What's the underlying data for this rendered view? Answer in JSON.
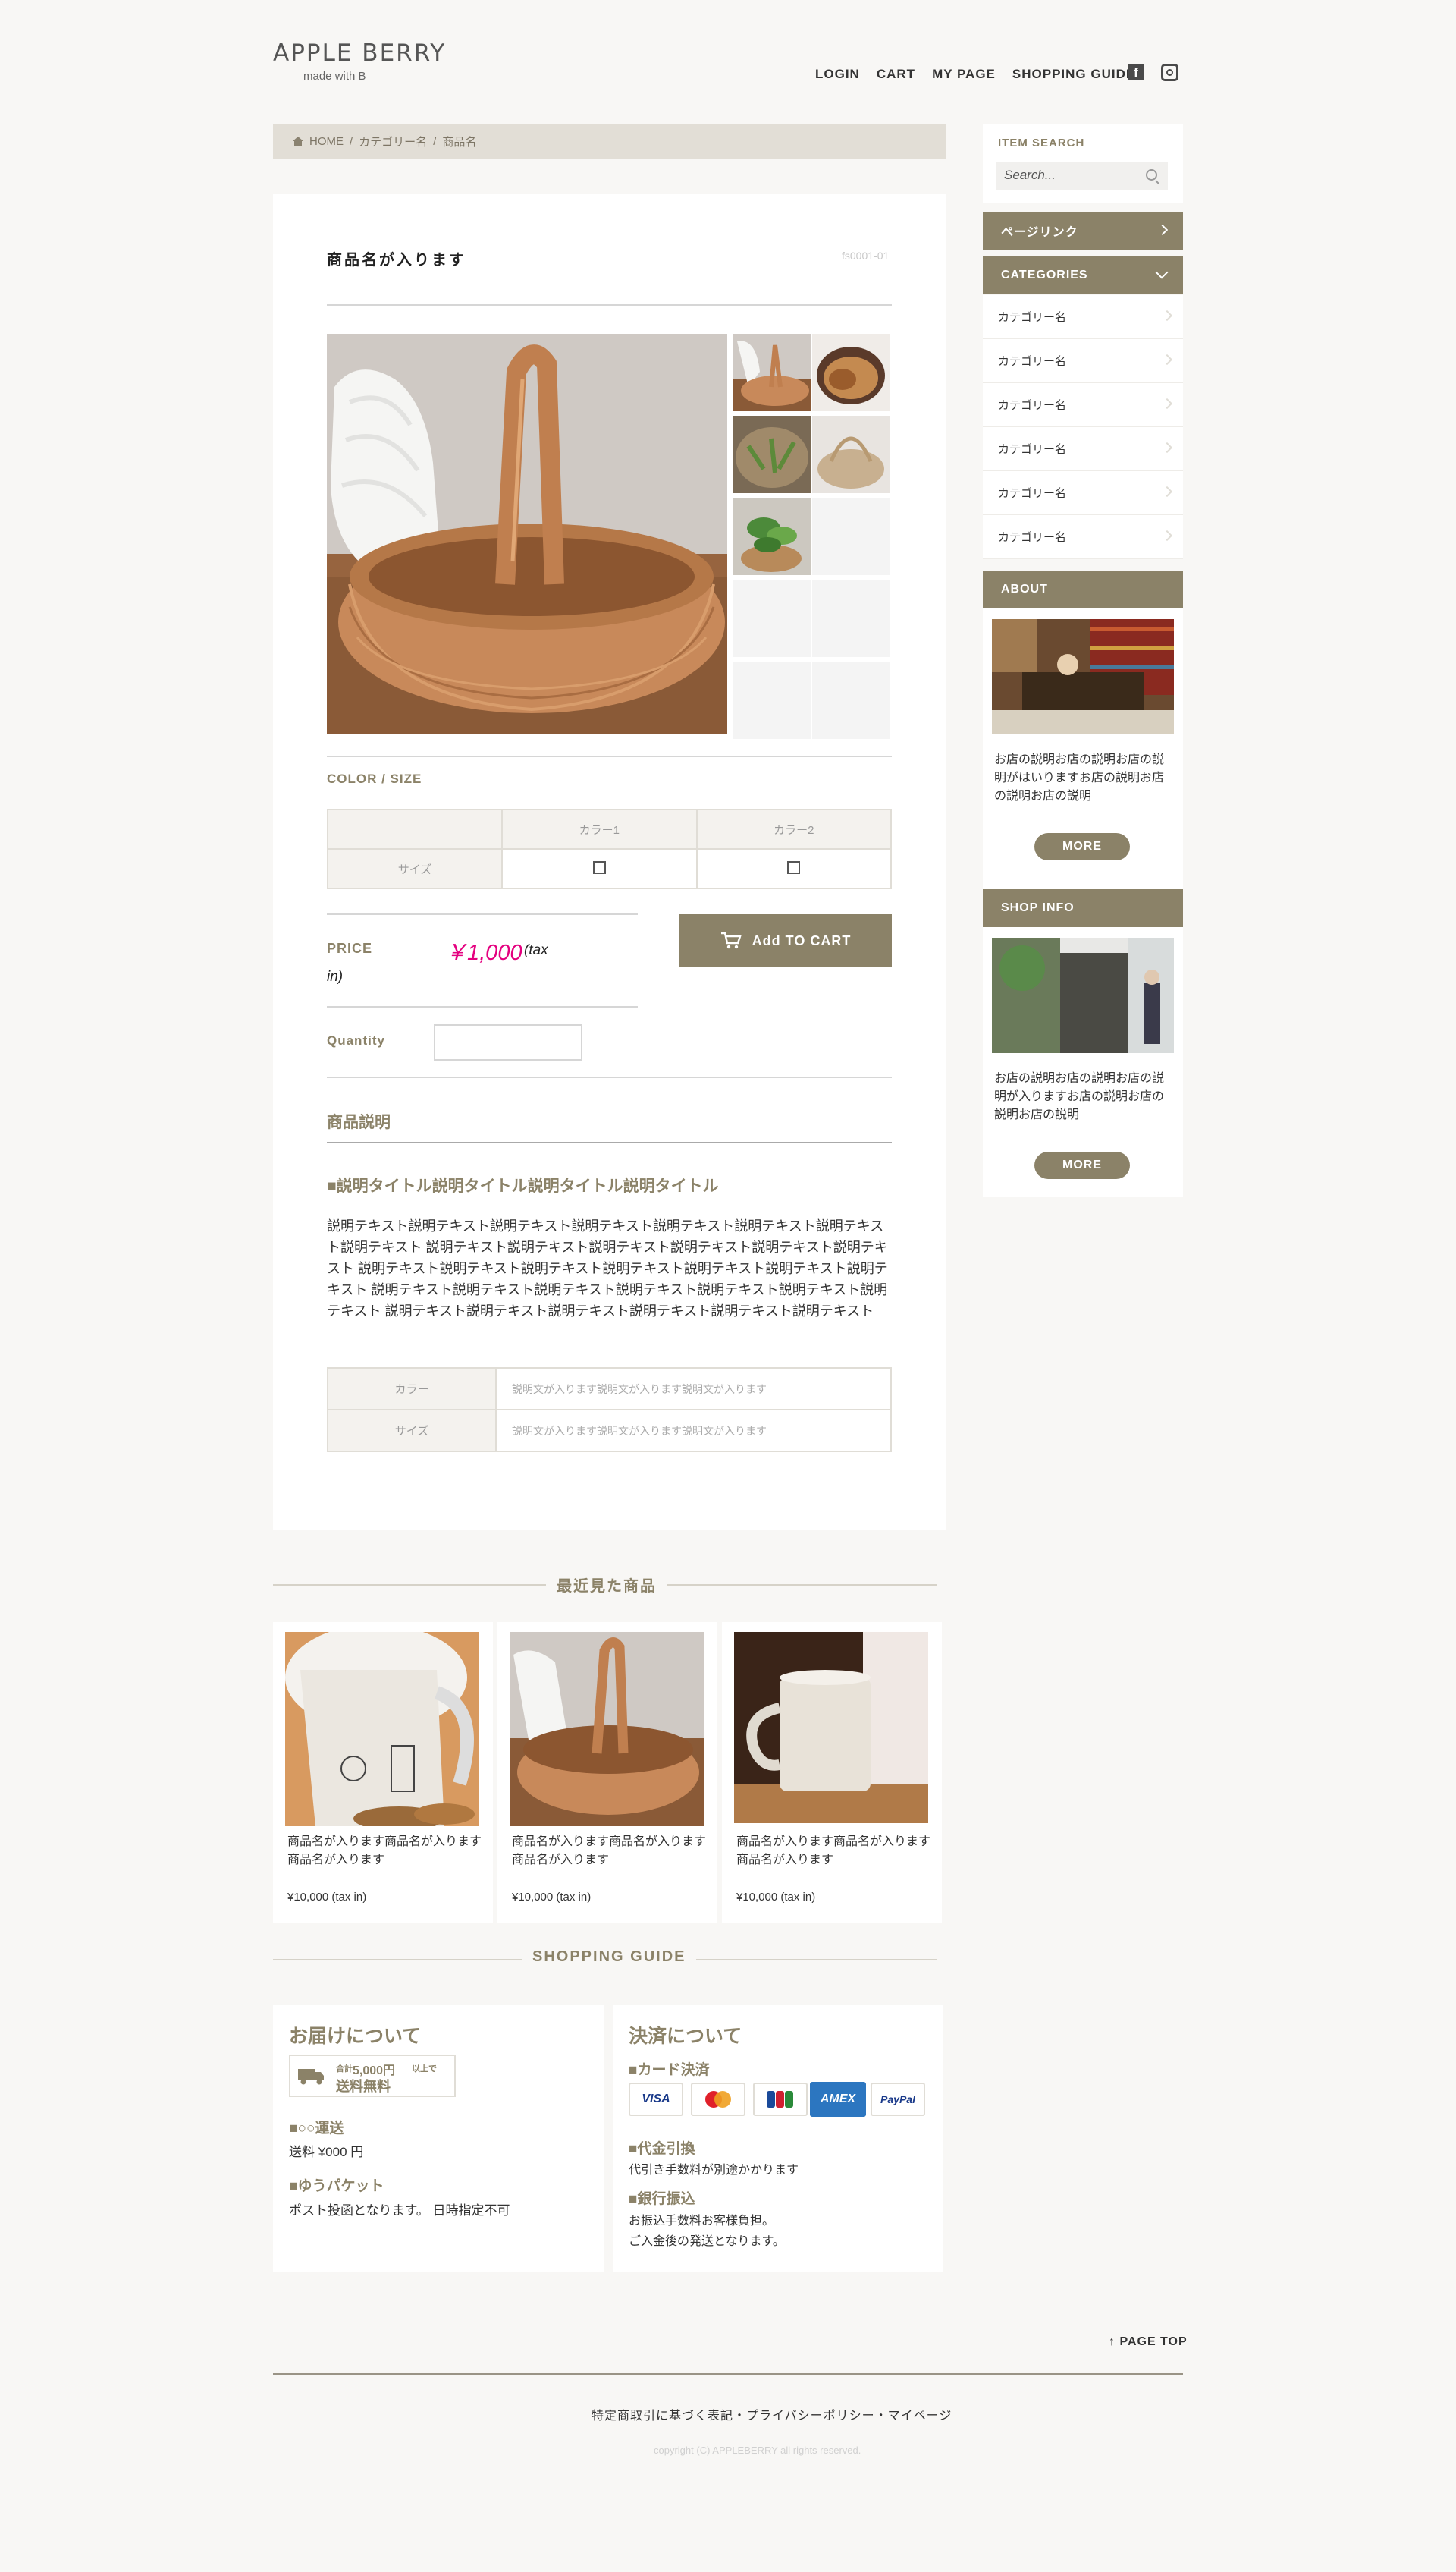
{
  "header": {
    "logo": "APPLE BERRY",
    "logo_sub": "made with B",
    "nav": [
      "LOGIN",
      "CART",
      "MY PAGE",
      "SHOPPING GUIDE"
    ]
  },
  "breadcrumb": [
    "HOME",
    "カテゴリー名",
    "商品名"
  ],
  "product": {
    "title": "商品名が入ります",
    "code": "fs0001-01",
    "color_size_label": "COLOR / SIZE",
    "colors": [
      "カラー1",
      "カラー2"
    ],
    "size_label": "サイズ",
    "price_label": "PRICE",
    "price": "￥1,000",
    "tax_part1": "(tax",
    "tax_part2": "in)",
    "cart_button": "Add TO CART",
    "quantity_label": "Quantity",
    "description_head": "商品説明",
    "description_title": "■説明タイトル説明タイトル説明タイトル説明タイトル",
    "description_text": "説明テキスト説明テキスト説明テキスト説明テキスト説明テキスト説明テキスト説明テキスト説明テキスト 説明テキスト説明テキスト説明テキスト説明テキスト説明テキスト説明テキスト 説明テキスト説明テキスト説明テキスト説明テキスト説明テキスト説明テキスト説明テキスト 説明テキスト説明テキスト説明テキスト説明テキスト説明テキスト説明テキスト説明テキスト 説明テキスト説明テキスト説明テキスト説明テキスト説明テキスト説明テキスト",
    "spec": [
      {
        "key": "カラー",
        "value": "説明文が入ります説明文が入ります説明文が入ります"
      },
      {
        "key": "サイズ",
        "value": "説明文が入ります説明文が入ります説明文が入ります"
      }
    ]
  },
  "sidebar": {
    "search_label": "ITEM SEARCH",
    "search_placeholder": "Search...",
    "page_link": "ページリンク",
    "categories_label": "CATEGORIES",
    "categories": [
      "カテゴリー名",
      "カテゴリー名",
      "カテゴリー名",
      "カテゴリー名",
      "カテゴリー名",
      "カテゴリー名"
    ],
    "about_label": "ABOUT",
    "about_text": "お店の説明お店の説明お店の説明がはいりますお店の説明お店の説明お店の説明",
    "more": "MORE",
    "shop_label": "SHOP INFO",
    "shop_text": "お店の説明お店の説明お店の説明が入りますお店の説明お店の説明お店の説明"
  },
  "recent": {
    "title": "最近見た商品",
    "items": [
      {
        "name1": "商品名が入ります商品名が入ります",
        "name2": "商品名が入ります",
        "price": "¥10,000 (tax in)"
      },
      {
        "name1": "商品名が入ります商品名が入ります",
        "name2": "商品名が入ります",
        "price": "¥10,000 (tax in)"
      },
      {
        "name1": "商品名が入ります商品名が入ります",
        "name2": "商品名が入ります",
        "price": "¥10,000 (tax in)"
      }
    ]
  },
  "guide": {
    "title": "SHOPPING GUIDE",
    "delivery_head": "お届けについて",
    "free_small1": "合計",
    "free_amount": "5,000円",
    "free_small2": "以上で",
    "free_text": "送料無料",
    "ship_title": "■○○運送",
    "ship_text": "送料 ¥000 円",
    "packet_title": "■ゆうパケット",
    "packet_text": "ポスト投函となります。 日時指定不可",
    "payment_head": "決済について",
    "card_title": "■カード決済",
    "cards": [
      "VISA",
      "MC",
      "JCB",
      "AMEX",
      "PayPal"
    ],
    "cod_title": "■代金引換",
    "cod_text": "代引き手数料が別途かかります",
    "bank_title": "■銀行振込",
    "bank_text1": "お振込手数料お客様負担。",
    "bank_text2": "ご入金後の発送となります。"
  },
  "footer": {
    "page_top": "PAGE TOP",
    "links": "特定商取引に基づく表記・プライバシーポリシー・マイページ",
    "copyright": "copyright (C) APPLEBERRY all rights reserved."
  },
  "colors": {
    "accent": "#8b8268",
    "price": "#e4007f",
    "amex": "#2c76c0"
  }
}
